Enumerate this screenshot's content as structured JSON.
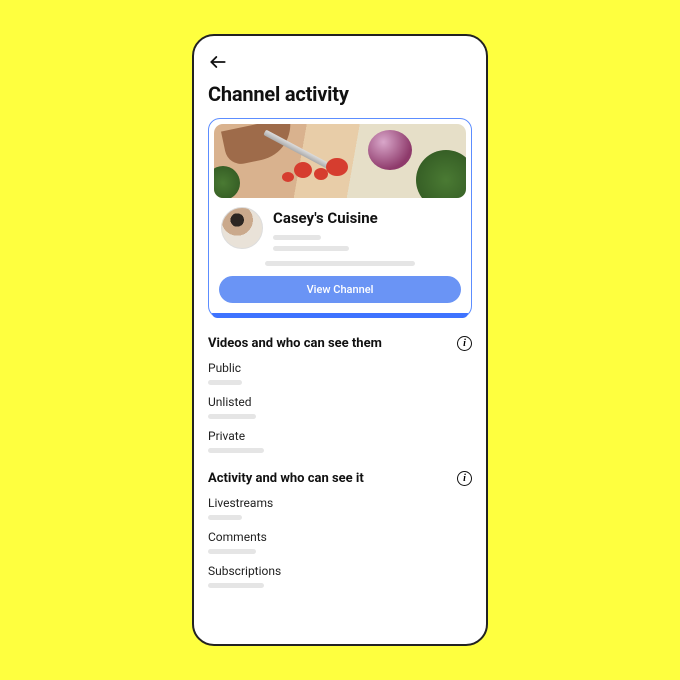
{
  "header": {
    "page_title": "Channel activity"
  },
  "channel_card": {
    "name": "Casey's Cuisine",
    "button_label": "View Channel"
  },
  "sections": [
    {
      "title": "Videos and who can see them",
      "items": [
        {
          "label": "Public",
          "skel_width": 34
        },
        {
          "label": "Unlisted",
          "skel_width": 48
        },
        {
          "label": "Private",
          "skel_width": 56
        }
      ]
    },
    {
      "title": "Activity and who can see it",
      "items": [
        {
          "label": "Livestreams",
          "skel_width": 34
        },
        {
          "label": "Comments",
          "skel_width": 48
        },
        {
          "label": "Subscriptions",
          "skel_width": 56
        }
      ]
    }
  ]
}
